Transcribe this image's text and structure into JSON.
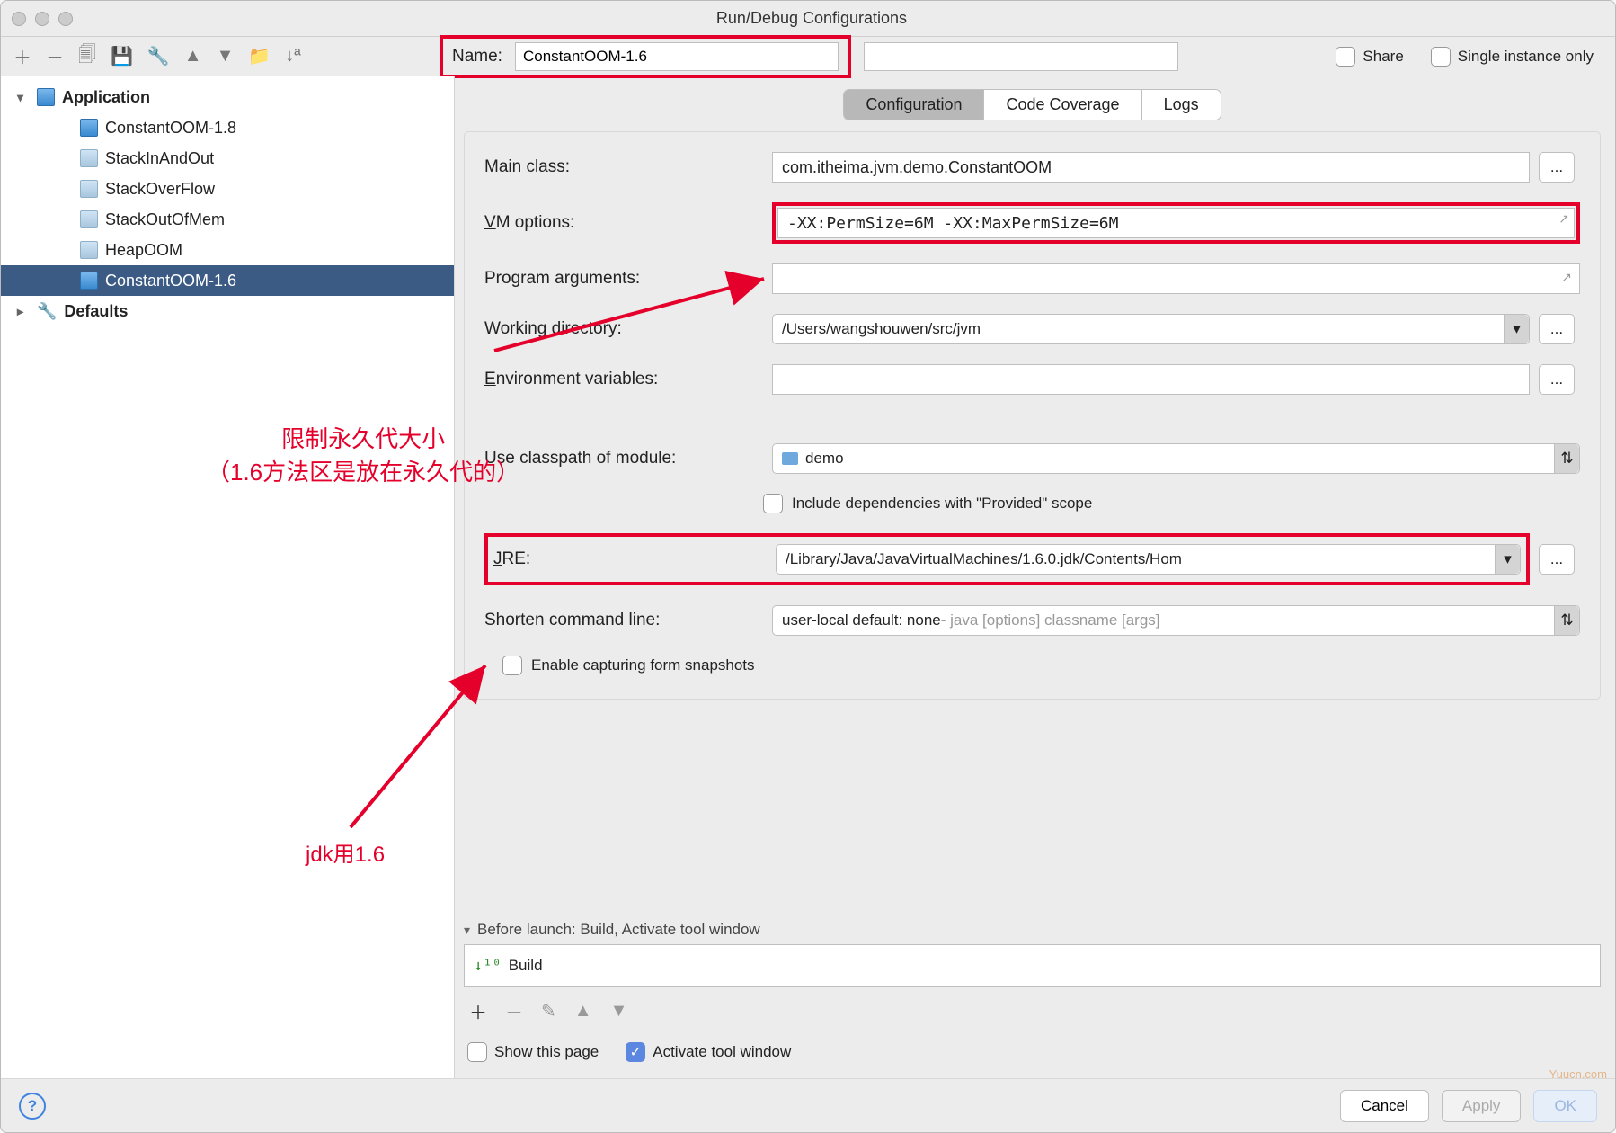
{
  "window": {
    "title": "Run/Debug Configurations"
  },
  "toolbar": {
    "name_label": "Name:",
    "name_value": "ConstantOOM-1.6",
    "share_label": "Share",
    "single_instance_label": "Single instance only"
  },
  "sidebar": {
    "root": "Application",
    "items": [
      "ConstantOOM-1.8",
      "StackInAndOut",
      "StackOverFlow",
      "StackOutOfMem",
      "HeapOOM",
      "ConstantOOM-1.6"
    ],
    "defaults": "Defaults"
  },
  "tabs": {
    "configuration": "Configuration",
    "coverage": "Code Coverage",
    "logs": "Logs"
  },
  "config": {
    "main_class_label": "Main class:",
    "main_class": "com.itheima.jvm.demo.ConstantOOM",
    "vm_options_label": "VM options:",
    "vm_options": "-XX:PermSize=6M -XX:MaxPermSize=6M",
    "program_args_label": "Program arguments:",
    "program_args": "",
    "working_dir_label": "Working directory:",
    "working_dir": "/Users/wangshouwen/src/jvm",
    "env_vars_label": "Environment variables:",
    "env_vars": "",
    "classpath_label": "Use classpath of module:",
    "classpath_module": "demo",
    "include_deps_label": "Include dependencies with \"Provided\" scope",
    "jre_label": "JRE:",
    "jre_path": "/Library/Java/JavaVirtualMachines/1.6.0.jdk/Contents/Hom",
    "shorten_label": "Shorten command line:",
    "shorten_value_prefix": "user-local default: none",
    "shorten_value_suffix": " - java [options] classname [args]",
    "enable_snapshots_label": "Enable capturing form snapshots"
  },
  "before_launch": {
    "header": "Before launch: Build, Activate tool window",
    "item": "Build",
    "show_page_label": "Show this page",
    "activate_label": "Activate tool window"
  },
  "buttons": {
    "cancel": "Cancel",
    "apply": "Apply",
    "ok": "OK"
  },
  "annotations": {
    "permgen_line1": "限制永久代大小",
    "permgen_line2": "（1.6方法区是放在永久代的）",
    "jdk": "jdk用1.6",
    "watermark": "Yuucn.com"
  },
  "icons": {
    "ellipsis": "...",
    "caret_down": "▾",
    "caret_right": "▸",
    "plus": "＋",
    "minus": "－",
    "pencil": "✎",
    "up": "▲",
    "dn": "▼",
    "check": "✓",
    "updown": "⇅"
  }
}
